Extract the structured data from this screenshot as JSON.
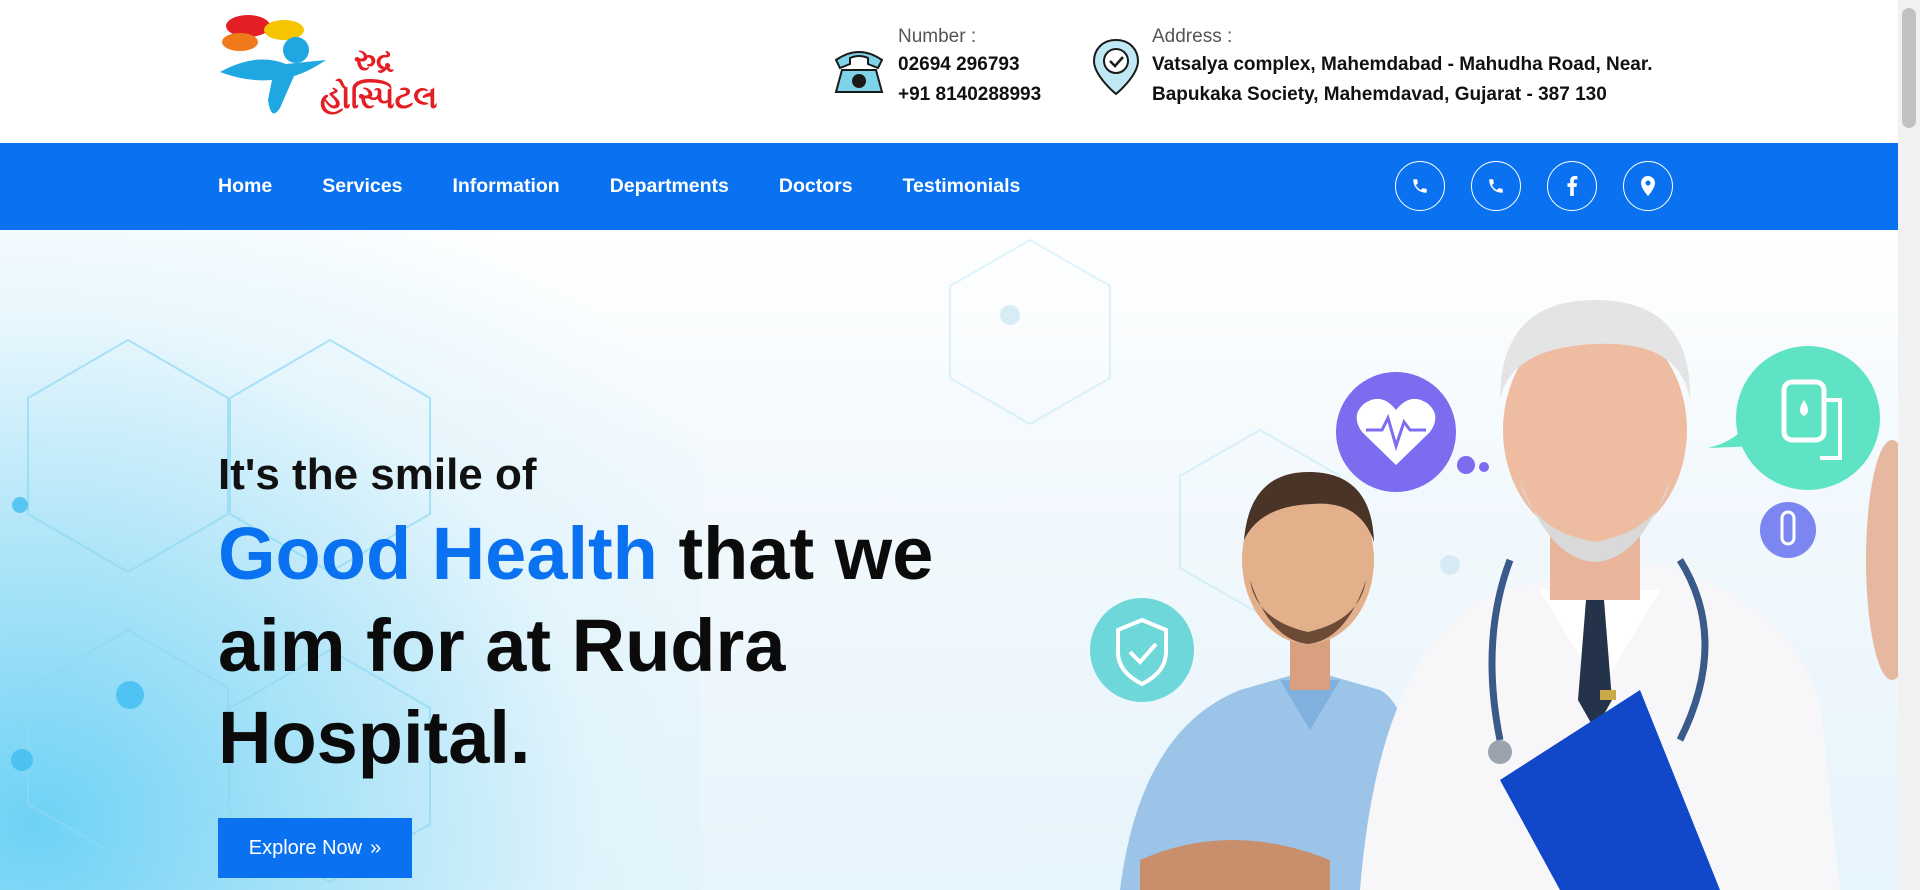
{
  "header": {
    "logo_alt": "રુદ્ર હોસ્પિટલ",
    "phone": {
      "label": "Number :",
      "line1": "02694 296793",
      "line2": "+91 8140288993"
    },
    "address": {
      "label": "Address :",
      "line1": "Vatsalya complex, Mahemdabad - Mahudha Road, Near.",
      "line2": "Bapukaka Society, Mahemdavad, Gujarat - 387 130"
    }
  },
  "nav": {
    "items": [
      {
        "label": "Home"
      },
      {
        "label": "Services"
      },
      {
        "label": "Information"
      },
      {
        "label": "Departments"
      },
      {
        "label": "Doctors"
      },
      {
        "label": "Testimonials"
      }
    ],
    "social": [
      "phone-icon",
      "phone-icon",
      "facebook-icon",
      "location-pin-icon"
    ]
  },
  "hero": {
    "subtitle": "It's the smile of",
    "title_accent": "Good Health",
    "title_rest": "that we aim for at Rudra Hospital.",
    "cta_label": "Explore Now",
    "cta_arrow": "»"
  },
  "colors": {
    "primary": "#0a72f0",
    "logo_red": "#e31e24",
    "logo_cyan": "#1ea7e1"
  }
}
